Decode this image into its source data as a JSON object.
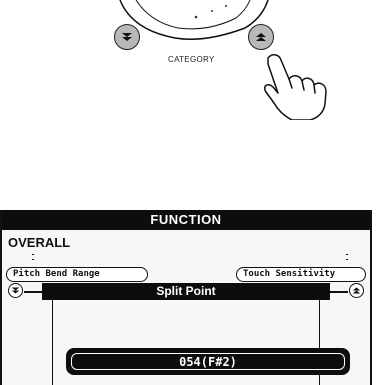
{
  "panel": {
    "category_label": "CATEGORY",
    "icons": [
      "category-down-arrow-icon",
      "category-up-arrow-icon",
      "pointing-hand-icon"
    ]
  },
  "display": {
    "title": "FUNCTION",
    "section": "OVERALL",
    "prev_item": "Pitch Bend Range",
    "next_item": "Touch Sensitivity",
    "current_item": "Split Point",
    "value": "054(F#2)"
  },
  "colors": {
    "lcd_dark": "#0d0d0d",
    "button_gray": "#b8b8b8",
    "lcd_background": "#f7f7f7"
  }
}
